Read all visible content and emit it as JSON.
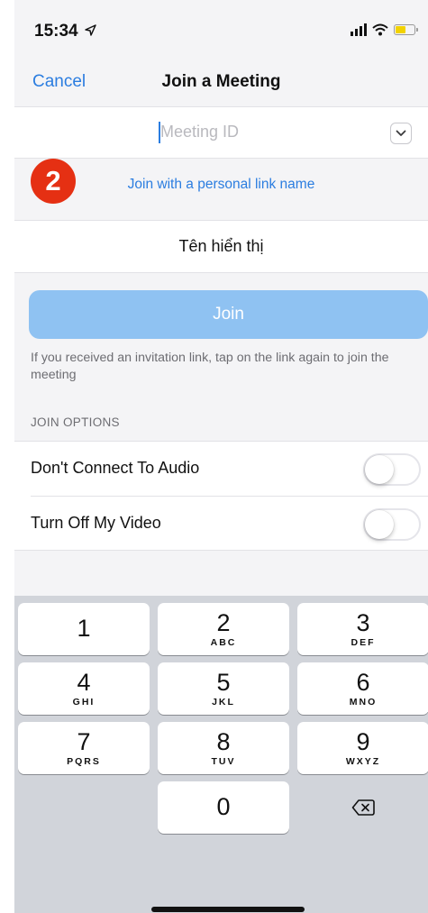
{
  "status_bar": {
    "time": "15:34",
    "location_icon": "location-arrow-icon",
    "battery_color": "#f2d200"
  },
  "nav": {
    "cancel_label": "Cancel",
    "title": "Join a Meeting"
  },
  "meeting_id": {
    "placeholder": "Meeting ID",
    "value": ""
  },
  "step_badge": "2",
  "personal_link_label": "Join with a personal link name",
  "display_name": {
    "value": "Tên hiển thị"
  },
  "join_button": {
    "label": "Join",
    "color": "#8fc2f2"
  },
  "hint_text": "If you received an invitation link, tap on the link again to join the meeting",
  "join_options": {
    "header": "JOIN OPTIONS",
    "items": [
      {
        "label": "Don't Connect To Audio",
        "enabled": false
      },
      {
        "label": "Turn Off My Video",
        "enabled": false
      }
    ]
  },
  "keypad": {
    "keys": [
      {
        "digit": "1",
        "letters": ""
      },
      {
        "digit": "2",
        "letters": "ABC"
      },
      {
        "digit": "3",
        "letters": "DEF"
      },
      {
        "digit": "4",
        "letters": "GHI"
      },
      {
        "digit": "5",
        "letters": "JKL"
      },
      {
        "digit": "6",
        "letters": "MNO"
      },
      {
        "digit": "7",
        "letters": "PQRS"
      },
      {
        "digit": "8",
        "letters": "TUV"
      },
      {
        "digit": "9",
        "letters": "WXYZ"
      },
      {
        "digit": "0",
        "letters": ""
      }
    ]
  },
  "accent_color": "#2b7de0"
}
